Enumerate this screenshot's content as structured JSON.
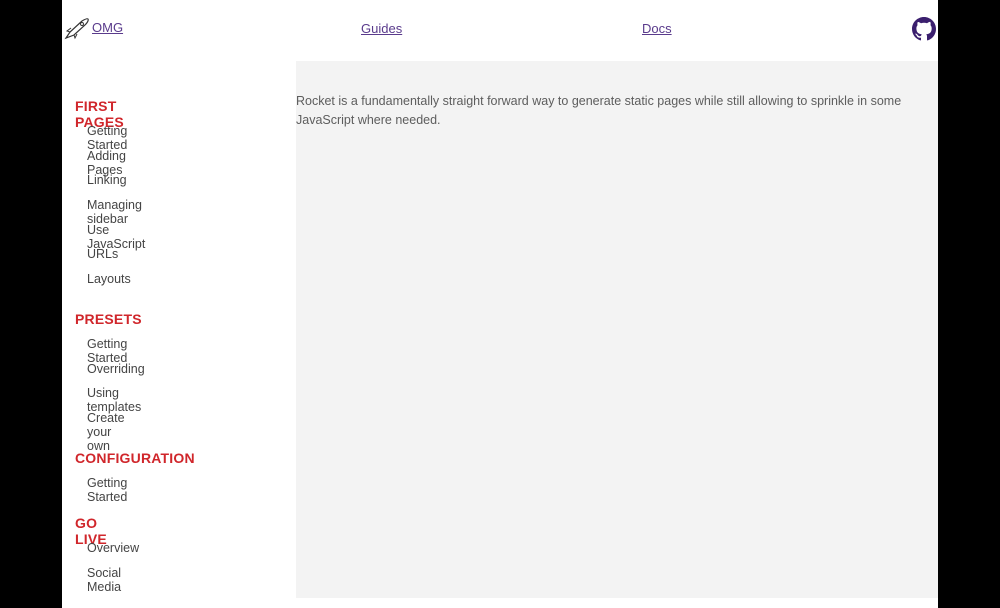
{
  "header": {
    "logo_text": " OMG",
    "nav": [
      {
        "label": "Guides"
      },
      {
        "label": "Docs"
      }
    ],
    "github_icon": "github-icon"
  },
  "sidebar": {
    "sections": [
      {
        "title": "FIRST PAGES",
        "items": [
          "Getting Started",
          "Adding Pages",
          "Linking",
          "Managing sidebar",
          "Use JavaScript",
          "URLs",
          "Layouts"
        ]
      },
      {
        "title": "PRESETS",
        "items": [
          "Getting Started",
          "Overriding",
          "Using templates",
          "Create your own"
        ]
      },
      {
        "title": "CONFIGURATION",
        "items": [
          "Getting Started"
        ]
      },
      {
        "title": "GO LIVE",
        "items": [
          "Overview",
          "Social Media"
        ]
      }
    ]
  },
  "main": {
    "intro": "Rocket is a fundamentally straight forward way to generate static pages while still allowing to sprinkle in some JavaScript where needed."
  },
  "colors": {
    "section_title": "#d0262b",
    "link": "#5a3b8c",
    "content_bg": "#f3f3f3"
  }
}
